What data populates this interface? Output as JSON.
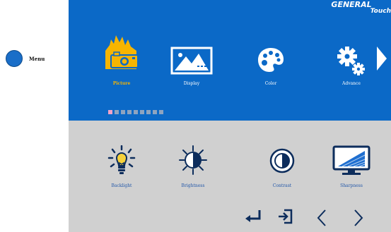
{
  "launcher": {
    "label": "Menu"
  },
  "brand": {
    "part1": "GENERAL",
    "part2": "Touch"
  },
  "categories": [
    {
      "label": "Picture",
      "icon": "picture-icon",
      "active": true
    },
    {
      "label": "Display",
      "icon": "display-icon",
      "active": false
    },
    {
      "label": "Color",
      "icon": "palette-icon",
      "active": false
    },
    {
      "label": "Advance",
      "icon": "gears-icon",
      "active": false
    }
  ],
  "pager": {
    "total": 9,
    "current": 1
  },
  "items": [
    {
      "label": "Backlight",
      "icon": "lightbulb-icon"
    },
    {
      "label": "Brightness",
      "icon": "sun-icon"
    },
    {
      "label": "Contrast",
      "icon": "contrast-icon"
    },
    {
      "label": "Sharpness",
      "icon": "monitor-icon"
    }
  ],
  "colors": {
    "panel_blue": "#0b69c7",
    "panel_gray": "#d0d0d0",
    "active_label": "#f7b500",
    "item_label": "#1f55a8"
  }
}
